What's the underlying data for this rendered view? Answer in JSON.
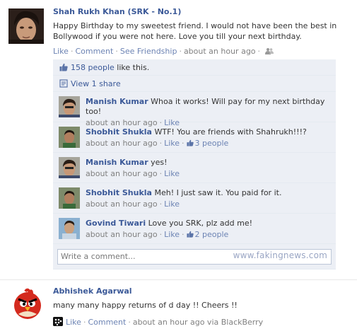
{
  "main_post": {
    "author": "Shah Rukh Khan (SRK - No.1)",
    "message": "Happy Birthday to my sweetest friend. I would not have been the best in Bollywood if you were not here. Love you till your next birthday.",
    "actions": {
      "like": "Like",
      "comment": "Comment",
      "see_friendship": "See Friendship"
    },
    "time": "about an hour ago",
    "audience_icon": "friends-icon"
  },
  "ufi": {
    "likes_link": "158 people",
    "likes_suffix": "like this.",
    "shares": "View 1 share",
    "comments": [
      {
        "author": "Manish Kumar",
        "text": "Whoa it works! Will pay for my next birthday too!",
        "time": "about an hour ago",
        "like": "Like",
        "likes": ""
      },
      {
        "author": "Shobhit Shukla",
        "text": "WTF! You are friends with Shahrukh!!!?",
        "time": "about an hour ago",
        "like": "Like",
        "likes": "3 people"
      },
      {
        "author": "Manish Kumar",
        "text": "yes!",
        "time": "about an hour ago",
        "like": "Like",
        "likes": ""
      },
      {
        "author": "Shobhit Shukla",
        "text": "Meh! I just saw it. You paid for it.",
        "time": "about an hour ago",
        "like": "Like",
        "likes": ""
      },
      {
        "author": "Govind Tiwari",
        "text": "Love you SRK, plz add me!",
        "time": "about an hour ago",
        "like": "Like",
        "likes": "2 people"
      }
    ],
    "write_placeholder": "Write a comment...",
    "watermark": "www.fakingnews.com"
  },
  "second_post": {
    "author": "Abhishek Agarwal",
    "message": "many many happy returns of d day !! Cheers !!",
    "actions": {
      "like": "Like",
      "comment": "Comment"
    },
    "time": "about an hour ago via BlackBerry",
    "device_icon": "blackberry-icon",
    "avatar_icon": "angry-bird-avatar"
  },
  "colors": {
    "link": "#3b5998",
    "ufi_bg": "#eceff5",
    "meta": "#808080"
  }
}
